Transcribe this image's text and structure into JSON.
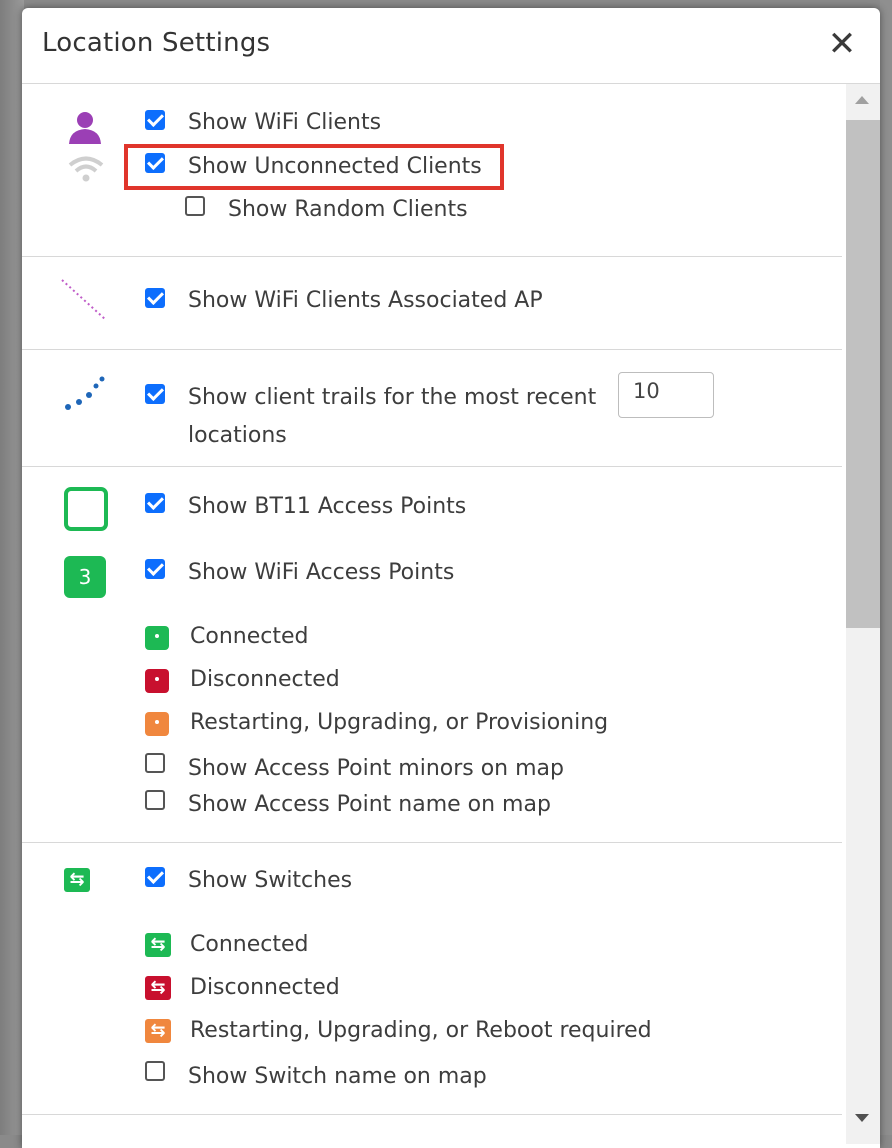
{
  "dialog": {
    "title": "Location Settings"
  },
  "clients": {
    "show_wifi_clients": {
      "label": "Show WiFi Clients",
      "checked": true
    },
    "show_unconnected_clients": {
      "label": "Show Unconnected Clients",
      "checked": true
    },
    "show_random_clients": {
      "label": "Show Random Clients",
      "checked": false
    }
  },
  "associated_ap": {
    "label": "Show WiFi Clients Associated AP",
    "checked": true
  },
  "trails": {
    "label_line1": "Show client trails for the most recent",
    "label_line2": "locations",
    "checked": true,
    "count_value": "10"
  },
  "access_points": {
    "show_bt11": {
      "label": "Show BT11 Access Points",
      "checked": true
    },
    "show_wifi_ap": {
      "label": "Show WiFi Access Points",
      "checked": true
    },
    "wifi_ap_badge": "3",
    "legend": [
      {
        "label": "Connected",
        "color": "#1db954"
      },
      {
        "label": "Disconnected",
        "color": "#c8102e"
      },
      {
        "label": "Restarting, Upgrading, or Provisioning",
        "color": "#f0873e"
      }
    ],
    "show_minors": {
      "label": "Show Access Point minors on map",
      "checked": false
    },
    "show_name": {
      "label": "Show Access Point name on map",
      "checked": false
    }
  },
  "switches": {
    "show_switches": {
      "label": "Show Switches",
      "checked": true
    },
    "legend": [
      {
        "label": "Connected",
        "color": "#1db954"
      },
      {
        "label": "Disconnected",
        "color": "#c8102e"
      },
      {
        "label": "Restarting, Upgrading, or Reboot required",
        "color": "#f0873e"
      }
    ],
    "show_name": {
      "label": "Show Switch name on map",
      "checked": false
    }
  },
  "icons": {
    "close": "close-icon",
    "client": "person-icon",
    "wifi": "wifi-icon",
    "associated": "dotted-line-icon",
    "trail": "trail-dots-icon",
    "bt11": "bt11-ap-icon",
    "wifi_ap": "wifi-ap-icon",
    "switch": "switch-icon"
  },
  "colors": {
    "checkbox_accent": "#0d6efd",
    "highlight": "#e0352b",
    "client_icon": "#9b3fb5",
    "trail_dots": "#1e66b8",
    "ap_green": "#1db954"
  }
}
